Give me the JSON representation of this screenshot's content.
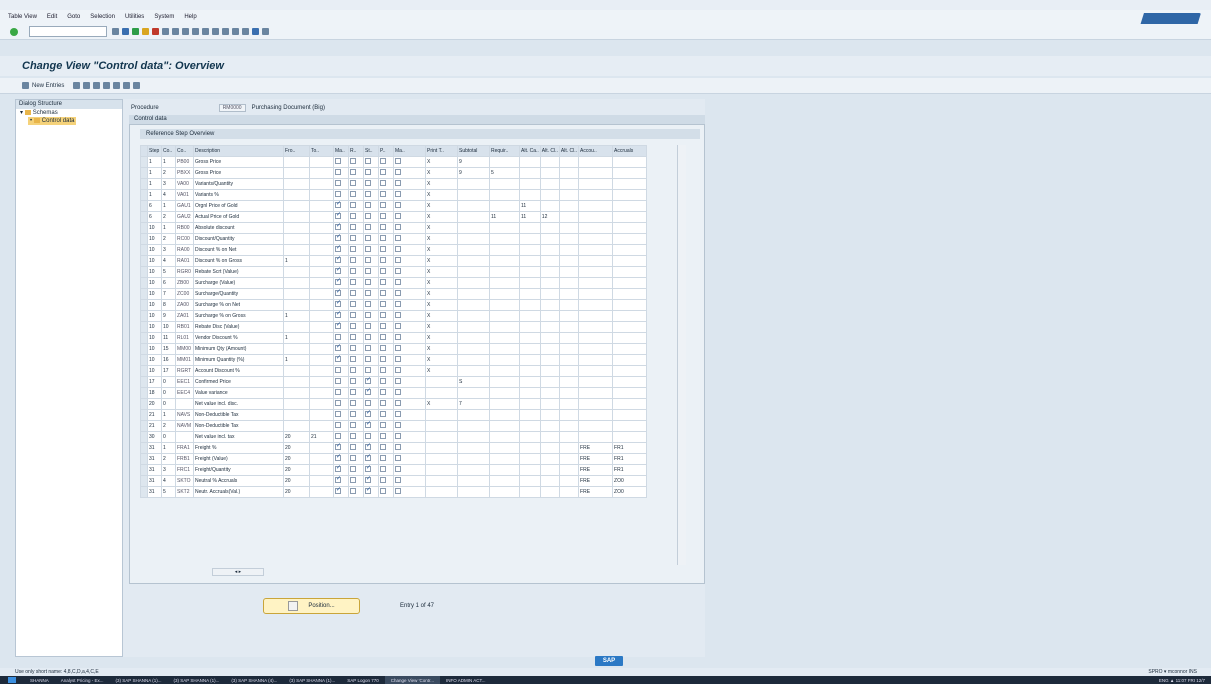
{
  "menu": [
    "Table View",
    "Edit",
    "Goto",
    "Selection",
    "Utilities",
    "System",
    "Help"
  ],
  "title": "Change View \"Control data\": Overview",
  "app_toolbar": {
    "new_entries": "New Entries"
  },
  "left_panel": {
    "header": "Dialog Structure",
    "items": [
      {
        "label": "Schemas",
        "selected": false
      },
      {
        "label": "Control data",
        "selected": true
      }
    ]
  },
  "procedure": {
    "label": "Procedure",
    "code": "RM0000",
    "text": "Purchasing Document (Big)"
  },
  "control_data_label": "Control data",
  "overview_label": "Reference Step Overview",
  "columns": [
    "Step",
    "Co..",
    "Co..",
    "Description",
    "Fro..",
    "To..",
    "Ma..",
    "R..",
    "St..",
    "P..",
    "Ma..",
    "Print T..",
    "Subtotal",
    "Requir..",
    "Alt. Ca..",
    "Alt. Cl..",
    "Alt. Cl..",
    "Accou..",
    "Accruals"
  ],
  "rows": [
    {
      "step": "1",
      "cnt": "1",
      "cond": "PB00",
      "desc": "Gross Price",
      "from": "",
      "to": "",
      "ma": false,
      "r": false,
      "st": false,
      "p": false,
      "print": "X",
      "sub": "9",
      "req": "",
      "altca": "",
      "altcb": "",
      "altcc": "",
      "acc": "",
      "accr": ""
    },
    {
      "step": "1",
      "cnt": "2",
      "cond": "PBXX",
      "desc": "Gross Price",
      "from": "",
      "to": "",
      "ma": false,
      "r": false,
      "st": false,
      "p": false,
      "print": "X",
      "sub": "9",
      "req": "5",
      "altca": "",
      "altcb": "",
      "altcc": "",
      "acc": "",
      "accr": ""
    },
    {
      "step": "1",
      "cnt": "3",
      "cond": "VA00",
      "desc": "Variants/Quantity",
      "from": "",
      "to": "",
      "ma": false,
      "r": false,
      "st": false,
      "p": false,
      "print": "X",
      "sub": "",
      "req": "",
      "altca": "",
      "altcb": "",
      "altcc": "",
      "acc": "",
      "accr": ""
    },
    {
      "step": "1",
      "cnt": "4",
      "cond": "VA01",
      "desc": "Variants %",
      "from": "",
      "to": "",
      "ma": false,
      "r": false,
      "st": false,
      "p": false,
      "print": "X",
      "sub": "",
      "req": "",
      "altca": "",
      "altcb": "",
      "altcc": "",
      "acc": "",
      "accr": ""
    },
    {
      "step": "6",
      "cnt": "1",
      "cond": "GAU1",
      "desc": "Orgnl Price of Gold",
      "from": "",
      "to": "",
      "ma": true,
      "r": false,
      "st": false,
      "p": false,
      "print": "X",
      "sub": "",
      "req": "",
      "altca": "11",
      "altcb": "",
      "altcc": "",
      "acc": "",
      "accr": ""
    },
    {
      "step": "6",
      "cnt": "2",
      "cond": "GAU2",
      "desc": "Actual Price of Gold",
      "from": "",
      "to": "",
      "ma": true,
      "r": false,
      "st": false,
      "p": false,
      "print": "X",
      "sub": "",
      "req": "11",
      "altca": "11",
      "altcb": "12",
      "altcc": "",
      "acc": "",
      "accr": ""
    },
    {
      "step": "10",
      "cnt": "1",
      "cond": "RB00",
      "desc": "Absolute discount",
      "from": "",
      "to": "",
      "ma": true,
      "r": false,
      "st": false,
      "p": false,
      "print": "X",
      "sub": "",
      "req": "",
      "altca": "",
      "altcb": "",
      "altcc": "",
      "acc": "",
      "accr": ""
    },
    {
      "step": "10",
      "cnt": "2",
      "cond": "RC00",
      "desc": "Discount/Quantity",
      "from": "",
      "to": "",
      "ma": true,
      "r": false,
      "st": false,
      "p": false,
      "print": "X",
      "sub": "",
      "req": "",
      "altca": "",
      "altcb": "",
      "altcc": "",
      "acc": "",
      "accr": ""
    },
    {
      "step": "10",
      "cnt": "3",
      "cond": "RA00",
      "desc": "Discount % on Net",
      "from": "",
      "to": "",
      "ma": true,
      "r": false,
      "st": false,
      "p": false,
      "print": "X",
      "sub": "",
      "req": "",
      "altca": "",
      "altcb": "",
      "altcc": "",
      "acc": "",
      "accr": ""
    },
    {
      "step": "10",
      "cnt": "4",
      "cond": "RA01",
      "desc": "Discount % on Gross",
      "from": "1",
      "to": "",
      "ma": true,
      "r": false,
      "st": false,
      "p": false,
      "print": "X",
      "sub": "",
      "req": "",
      "altca": "",
      "altcb": "",
      "altcc": "",
      "acc": "",
      "accr": ""
    },
    {
      "step": "10",
      "cnt": "5",
      "cond": "RGR0",
      "desc": "Rebate Scrt (Value)",
      "from": "",
      "to": "",
      "ma": true,
      "r": false,
      "st": false,
      "p": false,
      "print": "X",
      "sub": "",
      "req": "",
      "altca": "",
      "altcb": "",
      "altcc": "",
      "acc": "",
      "accr": ""
    },
    {
      "step": "10",
      "cnt": "6",
      "cond": "ZB00",
      "desc": "Surcharge (Value)",
      "from": "",
      "to": "",
      "ma": true,
      "r": false,
      "st": false,
      "p": false,
      "print": "X",
      "sub": "",
      "req": "",
      "altca": "",
      "altcb": "",
      "altcc": "",
      "acc": "",
      "accr": ""
    },
    {
      "step": "10",
      "cnt": "7",
      "cond": "ZC00",
      "desc": "Surcharge/Quantity",
      "from": "",
      "to": "",
      "ma": true,
      "r": false,
      "st": false,
      "p": false,
      "print": "X",
      "sub": "",
      "req": "",
      "altca": "",
      "altcb": "",
      "altcc": "",
      "acc": "",
      "accr": ""
    },
    {
      "step": "10",
      "cnt": "8",
      "cond": "ZA00",
      "desc": "Surcharge % on Net",
      "from": "",
      "to": "",
      "ma": true,
      "r": false,
      "st": false,
      "p": false,
      "print": "X",
      "sub": "",
      "req": "",
      "altca": "",
      "altcb": "",
      "altcc": "",
      "acc": "",
      "accr": ""
    },
    {
      "step": "10",
      "cnt": "9",
      "cond": "ZA01",
      "desc": "Surcharge % on Gross",
      "from": "1",
      "to": "",
      "ma": true,
      "r": false,
      "st": false,
      "p": false,
      "print": "X",
      "sub": "",
      "req": "",
      "altca": "",
      "altcb": "",
      "altcc": "",
      "acc": "",
      "accr": ""
    },
    {
      "step": "10",
      "cnt": "10",
      "cond": "RB01",
      "desc": "Rebate Disc (Value)",
      "from": "",
      "to": "",
      "ma": true,
      "r": false,
      "st": false,
      "p": false,
      "print": "X",
      "sub": "",
      "req": "",
      "altca": "",
      "altcb": "",
      "altcc": "",
      "acc": "",
      "accr": ""
    },
    {
      "step": "10",
      "cnt": "11",
      "cond": "RL01",
      "desc": "Vendor Discount %",
      "from": "1",
      "to": "",
      "ma": false,
      "r": false,
      "st": false,
      "p": false,
      "print": "X",
      "sub": "",
      "req": "",
      "altca": "",
      "altcb": "",
      "altcc": "",
      "acc": "",
      "accr": ""
    },
    {
      "step": "10",
      "cnt": "15",
      "cond": "MM00",
      "desc": "Minimum Qty (Amount)",
      "from": "",
      "to": "",
      "ma": true,
      "r": false,
      "st": false,
      "p": false,
      "print": "X",
      "sub": "",
      "req": "",
      "altca": "",
      "altcb": "",
      "altcc": "",
      "acc": "",
      "accr": ""
    },
    {
      "step": "10",
      "cnt": "16",
      "cond": "MM01",
      "desc": "Minimum Quantity (%)",
      "from": "1",
      "to": "",
      "ma": true,
      "r": false,
      "st": false,
      "p": false,
      "print": "X",
      "sub": "",
      "req": "",
      "altca": "",
      "altcb": "",
      "altcc": "",
      "acc": "",
      "accr": ""
    },
    {
      "step": "10",
      "cnt": "17",
      "cond": "RGRT",
      "desc": "Account Discount %",
      "from": "",
      "to": "",
      "ma": false,
      "r": false,
      "st": false,
      "p": false,
      "print": "X",
      "sub": "",
      "req": "",
      "altca": "",
      "altcb": "",
      "altcc": "",
      "acc": "",
      "accr": ""
    },
    {
      "step": "17",
      "cnt": "0",
      "cond": "EEC1",
      "desc": "Confirmed Price",
      "from": "",
      "to": "",
      "ma": false,
      "r": false,
      "st": true,
      "p": false,
      "print": "",
      "sub": "S",
      "req": "",
      "altca": "",
      "altcb": "",
      "altcc": "",
      "acc": "",
      "accr": ""
    },
    {
      "step": "18",
      "cnt": "0",
      "cond": "EEC4",
      "desc": "Value variance",
      "from": "",
      "to": "",
      "ma": false,
      "r": false,
      "st": true,
      "p": false,
      "print": "",
      "sub": "",
      "req": "",
      "altca": "",
      "altcb": "",
      "altcc": "",
      "acc": "",
      "accr": ""
    },
    {
      "step": "20",
      "cnt": "0",
      "cond": "",
      "desc": "Net value incl. disc.",
      "from": "",
      "to": "",
      "ma": false,
      "r": false,
      "st": false,
      "p": false,
      "print": "X",
      "sub": "7",
      "req": "",
      "altca": "",
      "altcb": "",
      "altcc": "",
      "acc": "",
      "accr": ""
    },
    {
      "step": "21",
      "cnt": "1",
      "cond": "NAVS",
      "desc": "Non-Deductible Tax",
      "from": "",
      "to": "",
      "ma": false,
      "r": false,
      "st": true,
      "p": false,
      "print": "",
      "sub": "",
      "req": "",
      "altca": "",
      "altcb": "",
      "altcc": "",
      "acc": "",
      "accr": ""
    },
    {
      "step": "21",
      "cnt": "2",
      "cond": "NAVM",
      "desc": "Non-Deductible Tax",
      "from": "",
      "to": "",
      "ma": false,
      "r": false,
      "st": true,
      "p": false,
      "print": "",
      "sub": "",
      "req": "",
      "altca": "",
      "altcb": "",
      "altcc": "",
      "acc": "",
      "accr": ""
    },
    {
      "step": "30",
      "cnt": "0",
      "cond": "",
      "desc": "Net value incl. tax",
      "from": "20",
      "to": "21",
      "ma": false,
      "r": false,
      "st": false,
      "p": false,
      "print": "",
      "sub": "",
      "req": "",
      "altca": "",
      "altcb": "",
      "altcc": "",
      "acc": "",
      "accr": ""
    },
    {
      "step": "31",
      "cnt": "1",
      "cond": "FRA1",
      "desc": "Freight %",
      "from": "20",
      "to": "",
      "ma": true,
      "r": false,
      "st": true,
      "p": false,
      "print": "",
      "sub": "",
      "req": "",
      "altca": "",
      "altcb": "",
      "altcc": "",
      "acc": "FRE",
      "accr": "FR1"
    },
    {
      "step": "31",
      "cnt": "2",
      "cond": "FRB1",
      "desc": "Freight (Value)",
      "from": "20",
      "to": "",
      "ma": true,
      "r": false,
      "st": true,
      "p": false,
      "print": "",
      "sub": "",
      "req": "",
      "altca": "",
      "altcb": "",
      "altcc": "",
      "acc": "FRE",
      "accr": "FR1"
    },
    {
      "step": "31",
      "cnt": "3",
      "cond": "FRC1",
      "desc": "Freight/Quantity",
      "from": "20",
      "to": "",
      "ma": true,
      "r": false,
      "st": true,
      "p": false,
      "print": "",
      "sub": "",
      "req": "",
      "altca": "",
      "altcb": "",
      "altcc": "",
      "acc": "FRE",
      "accr": "FR1"
    },
    {
      "step": "31",
      "cnt": "4",
      "cond": "SKTO",
      "desc": "Neutral % Accruals",
      "from": "20",
      "to": "",
      "ma": true,
      "r": false,
      "st": true,
      "p": false,
      "print": "",
      "sub": "",
      "req": "",
      "altca": "",
      "altcb": "",
      "altcc": "",
      "acc": "FRE",
      "accr": "ZO0"
    },
    {
      "step": "31",
      "cnt": "5",
      "cond": "SKT2",
      "desc": "Neutr. Accruals(Val.)",
      "from": "20",
      "to": "",
      "ma": true,
      "r": false,
      "st": true,
      "p": false,
      "print": "",
      "sub": "",
      "req": "",
      "altca": "",
      "altcb": "",
      "altcc": "",
      "acc": "FRE",
      "accr": "ZO0"
    }
  ],
  "position_button": "Position...",
  "entry_text": "Entry 1 of 47",
  "status_left": "Use only short name: 4,8,C,D,a,4,C,E",
  "status_right": "SPRO ▾  mconnor  INS",
  "sap_logo": "SAP",
  "taskbar": [
    "SHANNA",
    "Analyst Pricing - Ex...",
    "(3) SAP SHANNA (1)...",
    "(3) SAP SHANNA (1)...",
    "(3) SAP SHANNA (4)...",
    "(3) SAP SHANNA (1)...",
    "SAP Logon 770",
    "Change View 'Contr...",
    "INFO ADMIN ACT..."
  ],
  "taskbar_active": 7,
  "tray": "ENG  ▲  11:07  FRI  12/7"
}
